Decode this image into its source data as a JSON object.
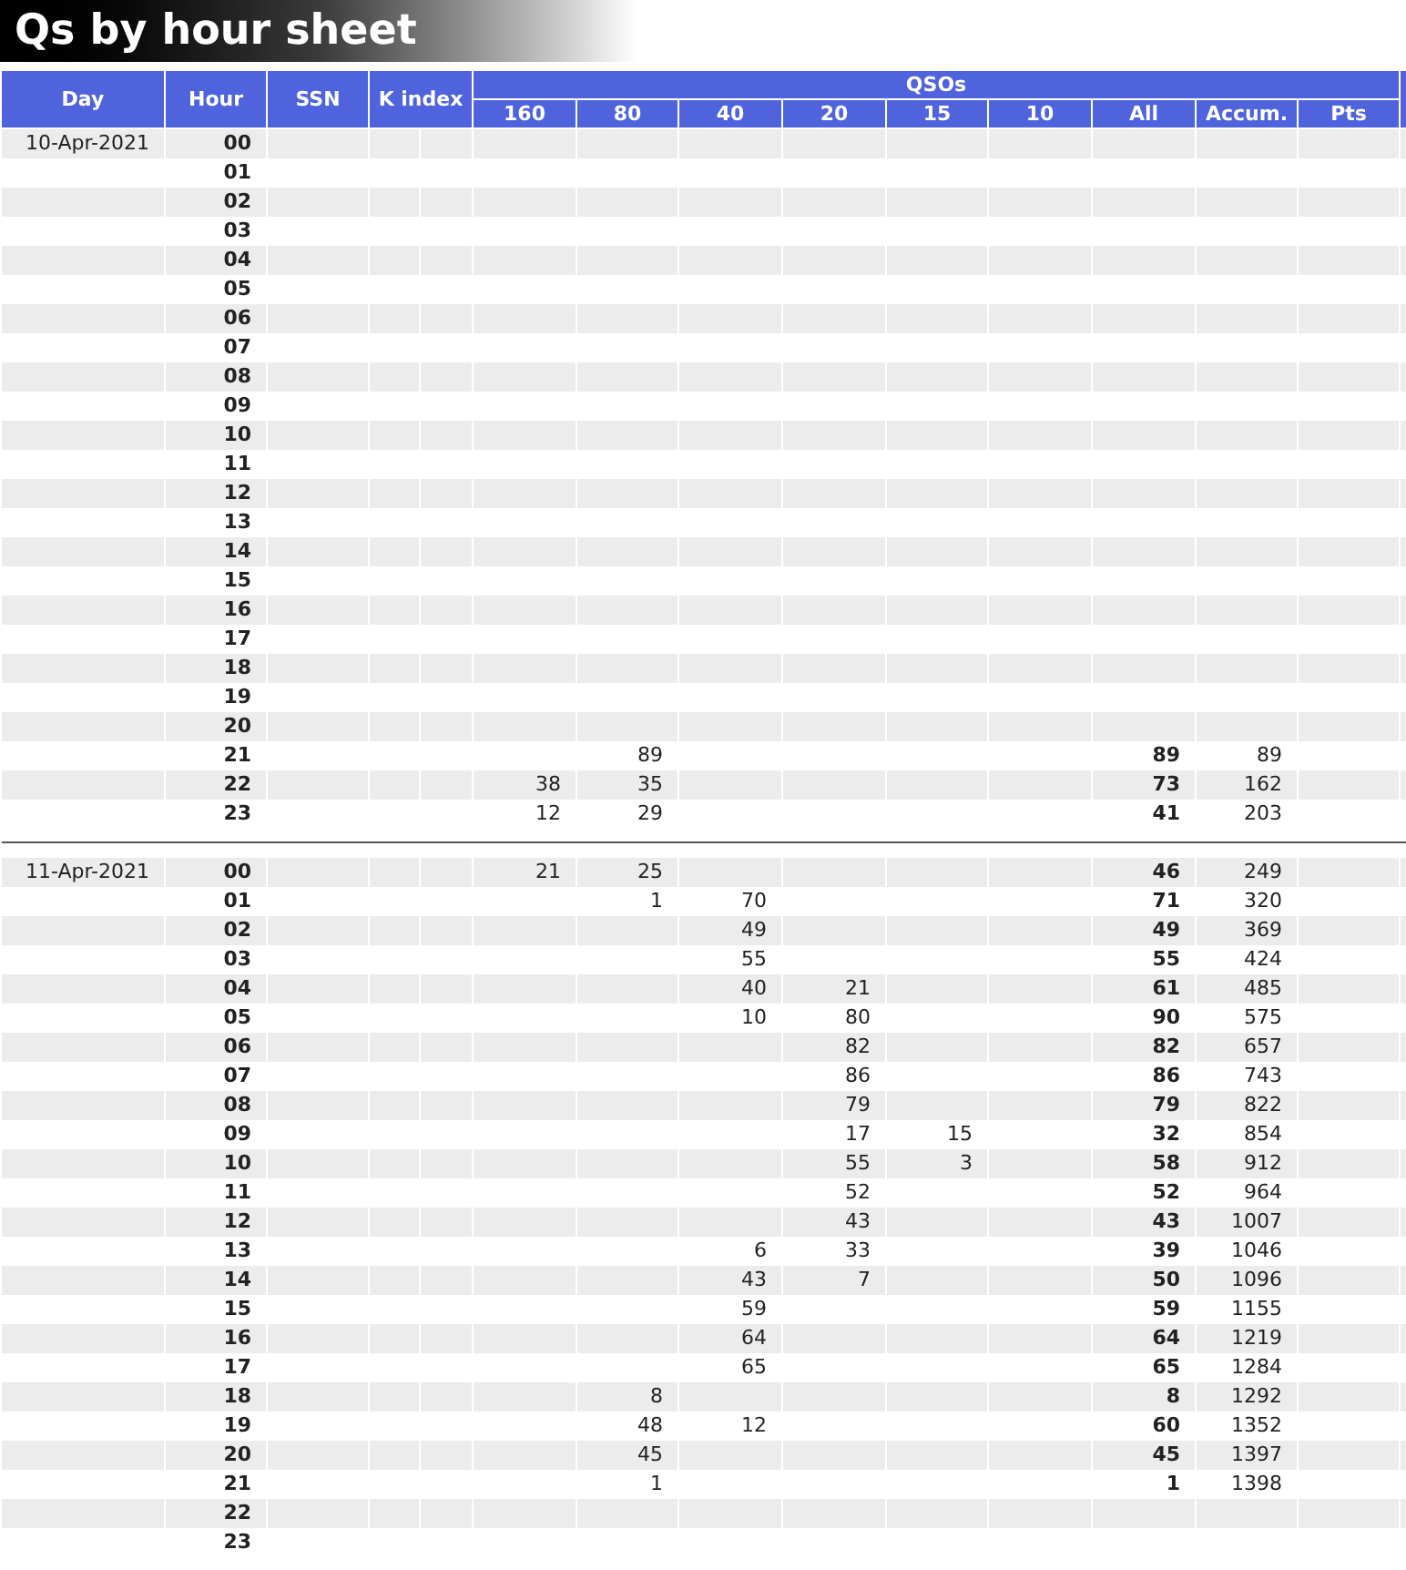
{
  "title": "Qs by hour sheet",
  "header": {
    "day": "Day",
    "hour": "Hour",
    "ssn": "SSN",
    "k_index": "K index",
    "group": "QSOs",
    "columns": [
      "160",
      "80",
      "40",
      "20",
      "15",
      "10",
      "All",
      "Accum.",
      "Pts"
    ]
  },
  "days": [
    {
      "day": "10-Apr-2021",
      "rows": [
        {
          "hour": "00"
        },
        {
          "hour": "01"
        },
        {
          "hour": "02"
        },
        {
          "hour": "03"
        },
        {
          "hour": "04"
        },
        {
          "hour": "05"
        },
        {
          "hour": "06"
        },
        {
          "hour": "07"
        },
        {
          "hour": "08"
        },
        {
          "hour": "09"
        },
        {
          "hour": "10"
        },
        {
          "hour": "11"
        },
        {
          "hour": "12"
        },
        {
          "hour": "13"
        },
        {
          "hour": "14"
        },
        {
          "hour": "15"
        },
        {
          "hour": "16"
        },
        {
          "hour": "17"
        },
        {
          "hour": "18"
        },
        {
          "hour": "19"
        },
        {
          "hour": "20"
        },
        {
          "hour": "21",
          "b80": "89",
          "all": "89",
          "accum": "89"
        },
        {
          "hour": "22",
          "b160": "38",
          "b80": "35",
          "all": "73",
          "accum": "162"
        },
        {
          "hour": "23",
          "b160": "12",
          "b80": "29",
          "all": "41",
          "accum": "203"
        }
      ]
    },
    {
      "day": "11-Apr-2021",
      "rows": [
        {
          "hour": "00",
          "b160": "21",
          "b80": "25",
          "all": "46",
          "accum": "249"
        },
        {
          "hour": "01",
          "b80": "1",
          "b40": "70",
          "all": "71",
          "accum": "320"
        },
        {
          "hour": "02",
          "b40": "49",
          "all": "49",
          "accum": "369"
        },
        {
          "hour": "03",
          "b40": "55",
          "all": "55",
          "accum": "424"
        },
        {
          "hour": "04",
          "b40": "40",
          "b20": "21",
          "all": "61",
          "accum": "485"
        },
        {
          "hour": "05",
          "b40": "10",
          "b20": "80",
          "all": "90",
          "accum": "575"
        },
        {
          "hour": "06",
          "b20": "82",
          "all": "82",
          "accum": "657"
        },
        {
          "hour": "07",
          "b20": "86",
          "all": "86",
          "accum": "743"
        },
        {
          "hour": "08",
          "b20": "79",
          "all": "79",
          "accum": "822"
        },
        {
          "hour": "09",
          "b20": "17",
          "b15": "15",
          "all": "32",
          "accum": "854"
        },
        {
          "hour": "10",
          "b20": "55",
          "b15": "3",
          "all": "58",
          "accum": "912"
        },
        {
          "hour": "11",
          "b20": "52",
          "all": "52",
          "accum": "964"
        },
        {
          "hour": "12",
          "b20": "43",
          "all": "43",
          "accum": "1007"
        },
        {
          "hour": "13",
          "b40": "6",
          "b20": "33",
          "all": "39",
          "accum": "1046"
        },
        {
          "hour": "14",
          "b40": "43",
          "b20": "7",
          "all": "50",
          "accum": "1096"
        },
        {
          "hour": "15",
          "b40": "59",
          "all": "59",
          "accum": "1155"
        },
        {
          "hour": "16",
          "b40": "64",
          "all": "64",
          "accum": "1219"
        },
        {
          "hour": "17",
          "b40": "65",
          "all": "65",
          "accum": "1284"
        },
        {
          "hour": "18",
          "b80": "8",
          "all": "8",
          "accum": "1292"
        },
        {
          "hour": "19",
          "b80": "48",
          "b40": "12",
          "all": "60",
          "accum": "1352"
        },
        {
          "hour": "20",
          "b80": "45",
          "all": "45",
          "accum": "1397"
        },
        {
          "hour": "21",
          "b80": "1",
          "all": "1",
          "accum": "1398"
        },
        {
          "hour": "22"
        },
        {
          "hour": "23"
        }
      ]
    }
  ]
}
